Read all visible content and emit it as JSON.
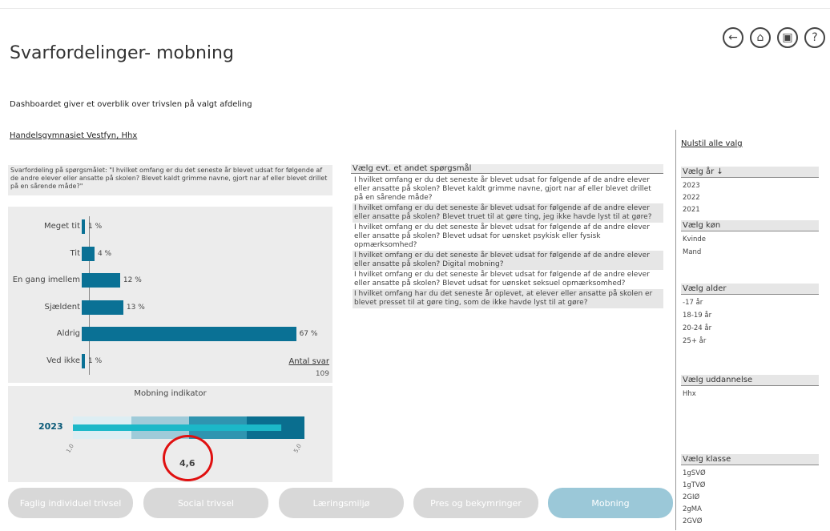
{
  "header": {
    "title": "Svarfordelinger- mobning",
    "subtitle": "Dashboardet giver et overblik over trivslen på valgt afdeling",
    "school": "Handelsgymnasiet Vestfyn, Hhx"
  },
  "icons": [
    "back-icon",
    "home-icon",
    "export-icon",
    "help-icon"
  ],
  "question": "Svarfordeling på spørgsmålet: \"I hvilket omfang er du det seneste år blevet udsat for følgende af de andre elever eller ansatte på skolen? Blevet kaldt grimme navne, gjort nar af eller blevet drillet på en sårende måde?\"",
  "colors": {
    "accent": "#0a7195",
    "tab_active": "#9bc8d8",
    "tab": "#d8d8d8",
    "highlight": "#e01010"
  },
  "chart_data": {
    "type": "bar",
    "categories": [
      "Meget tit",
      "Tit",
      "En gang imellem",
      "Sjældent",
      "Aldrig",
      "Ved ikke"
    ],
    "values": [
      1,
      4,
      12,
      13,
      67,
      1
    ],
    "value_labels": [
      "1 %",
      "4 %",
      "12 %",
      "13 %",
      "67 %",
      "1 %"
    ],
    "xlim": [
      0,
      70
    ]
  },
  "antal": {
    "label": "Antal svar",
    "value": "109"
  },
  "indicator": {
    "title": "Mobning indikator",
    "year": "2023",
    "value": 4.6,
    "value_label": "4,6",
    "min": 1,
    "max": 5,
    "min_label": "1,0",
    "max_label": "5,0"
  },
  "alt_questions": {
    "header": "Vælg evt. et andet spørgsmål",
    "items": [
      "I hvilket omfang er du det seneste år blevet udsat for følgende af de andre elever eller ansatte på skolen? Blevet kaldt grimme navne, gjort nar af eller blevet drillet på en sårende måde?",
      "I hvilket omfang er du det seneste år blevet udsat for følgende af de andre elever eller ansatte på skolen? Blevet truet til at gøre ting, jeg ikke havde lyst til at gøre?",
      "I hvilket omfang er du det seneste år blevet udsat for følgende af de andre elever eller ansatte på skolen? Blevet udsat for uønsket psykisk eller fysisk opmærksomhed?",
      "I hvilket omfang er du det seneste år blevet udsat for følgende af de andre elever eller ansatte på skolen? Digital mobning?",
      "I hvilket omfang er du det seneste år blevet udsat for følgende af de andre elever eller ansatte på skolen? Blevet udsat for uønsket seksuel opmærksomhed?",
      "I hvilket omfang har du det seneste år oplevet, at elever eller ansatte på skolen er blevet presset til at gøre ting, som de ikke havde lyst til at gøre?"
    ]
  },
  "filters": {
    "reset": "Nulstil alle valg",
    "year": {
      "label": "Vælg år",
      "items": [
        "2023",
        "2022",
        "2021"
      ]
    },
    "gender": {
      "label": "Vælg køn",
      "items": [
        "Kvinde",
        "Mand"
      ]
    },
    "age": {
      "label": "Vælg alder",
      "items": [
        "-17 år",
        "18-19 år",
        "20-24 år",
        "25+ år"
      ]
    },
    "education": {
      "label": "Vælg uddannelse",
      "items": [
        "Hhx"
      ]
    },
    "class": {
      "label": "Vælg klasse",
      "items": [
        "1gSVØ",
        "1gTVØ",
        "2GIØ",
        "2gMA",
        "2GVØ"
      ]
    }
  },
  "tabs": [
    {
      "label": "Faglig individuel trivsel",
      "active": false
    },
    {
      "label": "Social trivsel",
      "active": false
    },
    {
      "label": "Læringsmiljø",
      "active": false
    },
    {
      "label": "Pres og bekymringer",
      "active": false
    },
    {
      "label": "Mobning",
      "active": true
    }
  ]
}
